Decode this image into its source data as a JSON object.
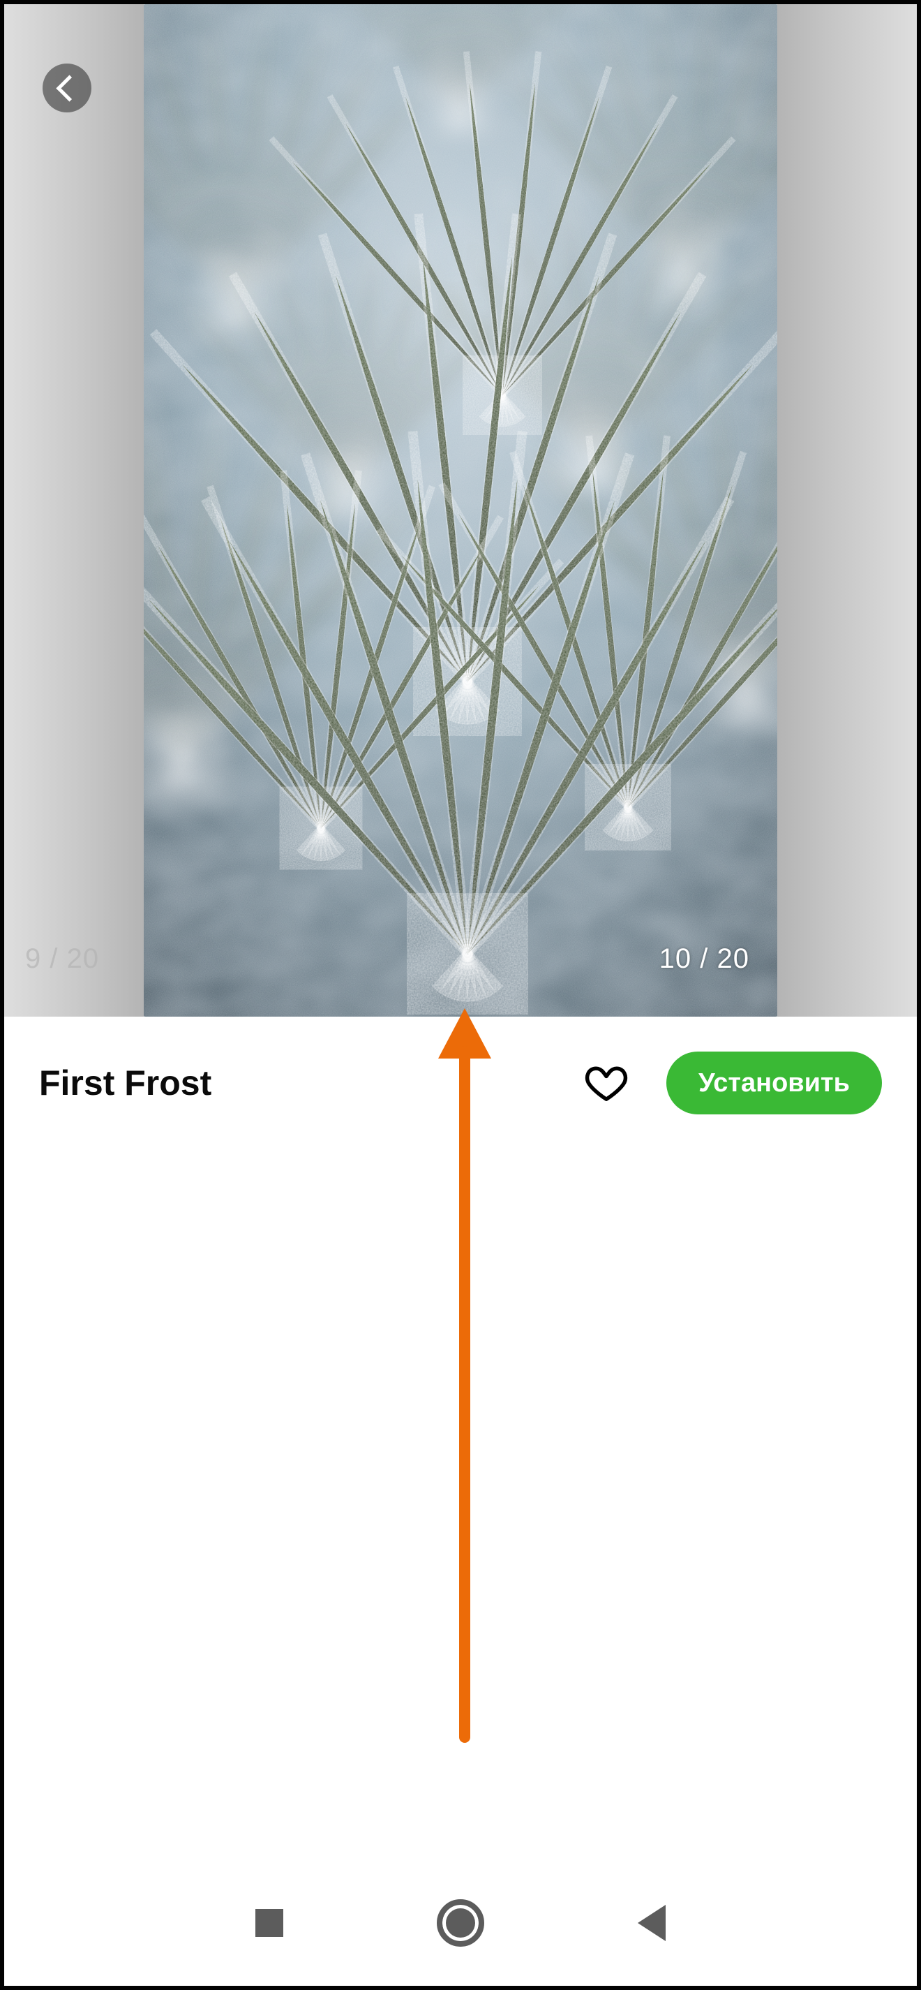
{
  "carousel": {
    "prev_counter": "9 / 20",
    "main_counter": "10 / 20"
  },
  "info": {
    "title": "First Frost",
    "install_label": "Установить"
  },
  "icons": {
    "back": "chevron-left-icon",
    "favorite": "heart-outline-icon",
    "nav_recent": "recent-apps-icon",
    "nav_home": "home-icon",
    "nav_back": "back-icon"
  },
  "colors": {
    "accent_green": "#3ab935",
    "annotation_orange": "#ec6b08"
  },
  "annotation": {
    "direction": "up"
  }
}
